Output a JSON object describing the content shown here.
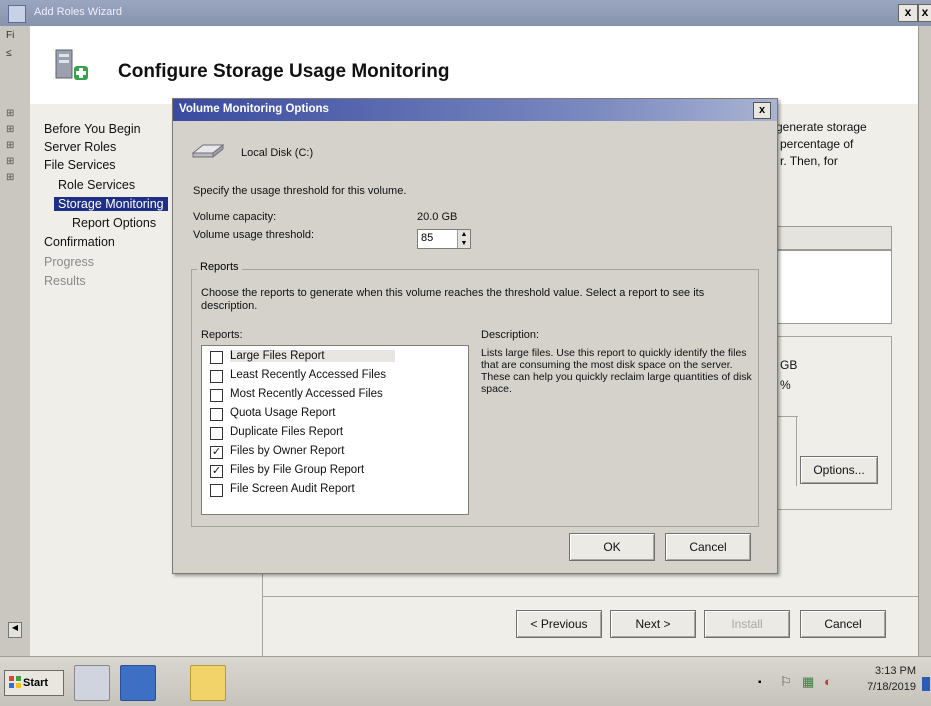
{
  "window": {
    "title": "Add Roles Wizard",
    "close_glyph": "x",
    "left_strip_chars": [
      "Fi",
      "≤"
    ]
  },
  "header": {
    "title": "Configure Storage Usage Monitoring"
  },
  "nav": [
    {
      "label": "Before You Begin"
    },
    {
      "label": "Server Roles"
    },
    {
      "label": "File Services"
    },
    {
      "label": "Role Services"
    },
    {
      "label": "Storage Monitoring"
    },
    {
      "label": "Report Options"
    },
    {
      "label": "Confirmation"
    },
    {
      "label": "Progress"
    },
    {
      "label": "Results"
    }
  ],
  "background_content": {
    "text_lines": [
      "generate storage",
      "percentage of",
      "r.  Then, for"
    ],
    "gb_text": "GB",
    "percent_text": "%",
    "options_button": "Options..."
  },
  "footer": {
    "previous": "< Previous",
    "next": "Next >",
    "install": "Install",
    "cancel": "Cancel"
  },
  "dialog": {
    "title": "Volume Monitoring Options",
    "disk_label": "Local Disk (C:)",
    "specify_text": "Specify the usage threshold for this volume.",
    "capacity_label": "Volume capacity:",
    "capacity_value": "20.0 GB",
    "threshold_label": "Volume usage threshold:",
    "threshold_value": "85",
    "reports_group": "Reports",
    "choose_text": "Choose the reports to generate when this volume reaches the threshold value. Select a report to see its description.",
    "reports_list_label": "Reports:",
    "description_label": "Description:",
    "description_text": "Lists large files. Use this report to quickly identify the files that are consuming the most disk space on the server. These can help you quickly reclaim large quantities of disk space.",
    "reports": [
      {
        "label": "Large Files Report",
        "checked": false
      },
      {
        "label": "Least Recently Accessed Files",
        "checked": false
      },
      {
        "label": "Most Recently Accessed Files",
        "checked": false
      },
      {
        "label": "Quota Usage Report",
        "checked": false
      },
      {
        "label": "Duplicate Files Report",
        "checked": false
      },
      {
        "label": "Files by Owner Report",
        "checked": true
      },
      {
        "label": "Files by File Group Report",
        "checked": true
      },
      {
        "label": "File Screen Audit Report",
        "checked": false
      }
    ],
    "ok": "OK",
    "cancel": "Cancel"
  },
  "taskbar": {
    "start": "Start",
    "time": "3:13 PM",
    "date": "7/18/2019"
  }
}
